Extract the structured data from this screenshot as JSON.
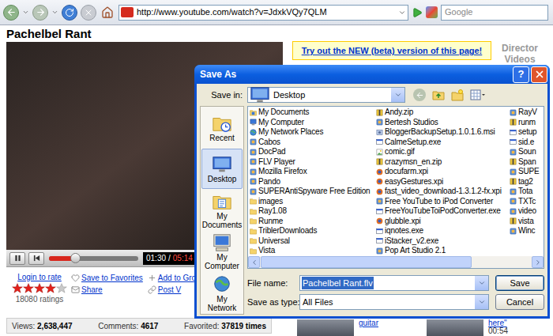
{
  "browser": {
    "url": "http://www.youtube.com/watch?v=JdxkVQy7QLM",
    "search_placeholder": "Google"
  },
  "page": {
    "title": "Pachelbel Rant",
    "player": {
      "playing": true,
      "level": 0.29,
      "elapsed": "01:30",
      "separator": "/",
      "total": "05:14"
    },
    "rating": {
      "login": "Login to rate",
      "stars": 4,
      "count": "18080 ratings"
    },
    "actions": [
      {
        "label": "Save to Favorites",
        "kind": "favorite"
      },
      {
        "label": "Add to Groups",
        "kind": "group"
      },
      {
        "label": "Share",
        "kind": "share"
      },
      {
        "label": "Post V",
        "kind": "post"
      }
    ],
    "stats": [
      {
        "label": "Views:",
        "value": "2,638,447"
      },
      {
        "label": "Comments:",
        "value": "4617"
      },
      {
        "label": "Favorited:",
        "value": "37819 times"
      }
    ],
    "beta_banner": "Try out the NEW (beta) version of this page!",
    "sidebar_heading": "Director Videos",
    "related": [
      {
        "title": "guitar"
      },
      {
        "title": "here\"",
        "duration": "00:54"
      }
    ]
  },
  "dialog": {
    "title": "Save As",
    "help_button": "?",
    "save_in": {
      "label": "Save in:",
      "value": "Desktop"
    },
    "places": [
      {
        "label": "Recent",
        "kind": "recent",
        "selected": false
      },
      {
        "label": "Desktop",
        "kind": "desktop",
        "selected": true
      },
      {
        "label": "My Documents",
        "kind": "documents",
        "selected": false
      },
      {
        "label": "My Computer",
        "kind": "computer",
        "selected": false
      },
      {
        "label": "My Network",
        "kind": "network",
        "selected": false
      }
    ],
    "files": [
      {
        "name": "My Documents",
        "kind": "documents",
        "selected": false
      },
      {
        "name": "My Computer",
        "kind": "computer",
        "selected": false
      },
      {
        "name": "My Network Places",
        "kind": "network",
        "selected": false
      },
      {
        "name": "Cabos",
        "kind": "app",
        "selected": false
      },
      {
        "name": "DocPad",
        "kind": "app",
        "selected": false
      },
      {
        "name": "FLV Player",
        "kind": "app",
        "selected": false
      },
      {
        "name": "Mozilla Firefox",
        "kind": "app",
        "selected": false
      },
      {
        "name": "Pando",
        "kind": "app",
        "selected": false
      },
      {
        "name": "SUPERAntiSpyware Free Edition",
        "kind": "app",
        "selected": false
      },
      {
        "name": "images",
        "kind": "folder",
        "selected": false
      },
      {
        "name": "Ray1.08",
        "kind": "folder",
        "selected": false
      },
      {
        "name": "Runme",
        "kind": "folder",
        "selected": false
      },
      {
        "name": "TriblerDownloads",
        "kind": "folder",
        "selected": false
      },
      {
        "name": "Universal",
        "kind": "folder",
        "selected": false
      },
      {
        "name": "Vista",
        "kind": "folder",
        "selected": false
      },
      {
        "name": "Andy.zip",
        "kind": "zip",
        "selected": false
      },
      {
        "name": "Bertesh Studios",
        "kind": "app",
        "selected": false
      },
      {
        "name": "BloggerBackupSetup.1.0.1.6.msi",
        "kind": "msi",
        "selected": false
      },
      {
        "name": "CalmeSetup.exe",
        "kind": "exe",
        "selected": false
      },
      {
        "name": "comic.gif",
        "kind": "gif",
        "selected": false
      },
      {
        "name": "crazymsn_en.zip",
        "kind": "zip",
        "selected": false
      },
      {
        "name": "docufarm.xpi",
        "kind": "xpi",
        "selected": false
      },
      {
        "name": "easyGestures.xpi",
        "kind": "xpi",
        "selected": false
      },
      {
        "name": "fast_video_download-1.3.1.2-fx.xpi",
        "kind": "xpi",
        "selected": false
      },
      {
        "name": "Free YouTube to iPod Converter",
        "kind": "app",
        "selected": false
      },
      {
        "name": "FreeYouTubeToiPodConverter.exe",
        "kind": "exe",
        "selected": false
      },
      {
        "name": "glubble.xpi",
        "kind": "xpi",
        "selected": false
      },
      {
        "name": "iqnotes.exe",
        "kind": "exe",
        "selected": false
      },
      {
        "name": "iStacker_v2.exe",
        "kind": "exe",
        "selected": false
      },
      {
        "name": "Pop Art Studio 2.1",
        "kind": "app",
        "selected": false
      },
      {
        "name": "RayV",
        "kind": "app",
        "selected": false
      },
      {
        "name": "runm",
        "kind": "zip",
        "selected": false
      },
      {
        "name": "setup",
        "kind": "exe",
        "selected": false
      },
      {
        "name": "sid.e",
        "kind": "exe",
        "selected": false
      },
      {
        "name": "Soun",
        "kind": "app",
        "selected": false
      },
      {
        "name": "Span",
        "kind": "zip",
        "selected": false
      },
      {
        "name": "SUPE",
        "kind": "app",
        "selected": false
      },
      {
        "name": "tag2",
        "kind": "zip",
        "selected": false
      },
      {
        "name": "Tota",
        "kind": "app",
        "selected": false
      },
      {
        "name": "TXTc",
        "kind": "app",
        "selected": false
      },
      {
        "name": "video",
        "kind": "app",
        "selected": false
      },
      {
        "name": "vista",
        "kind": "zip",
        "selected": false
      },
      {
        "name": "Winc",
        "kind": "app",
        "selected": false
      }
    ],
    "file_name": {
      "label": "File name:",
      "value": "Pachelbel Rant.flv",
      "selected": true
    },
    "save_as_type": {
      "label": "Save as type:",
      "value": "All Files"
    },
    "buttons": [
      {
        "label": "Save",
        "default": true
      },
      {
        "label": "Cancel",
        "default": false
      }
    ]
  }
}
